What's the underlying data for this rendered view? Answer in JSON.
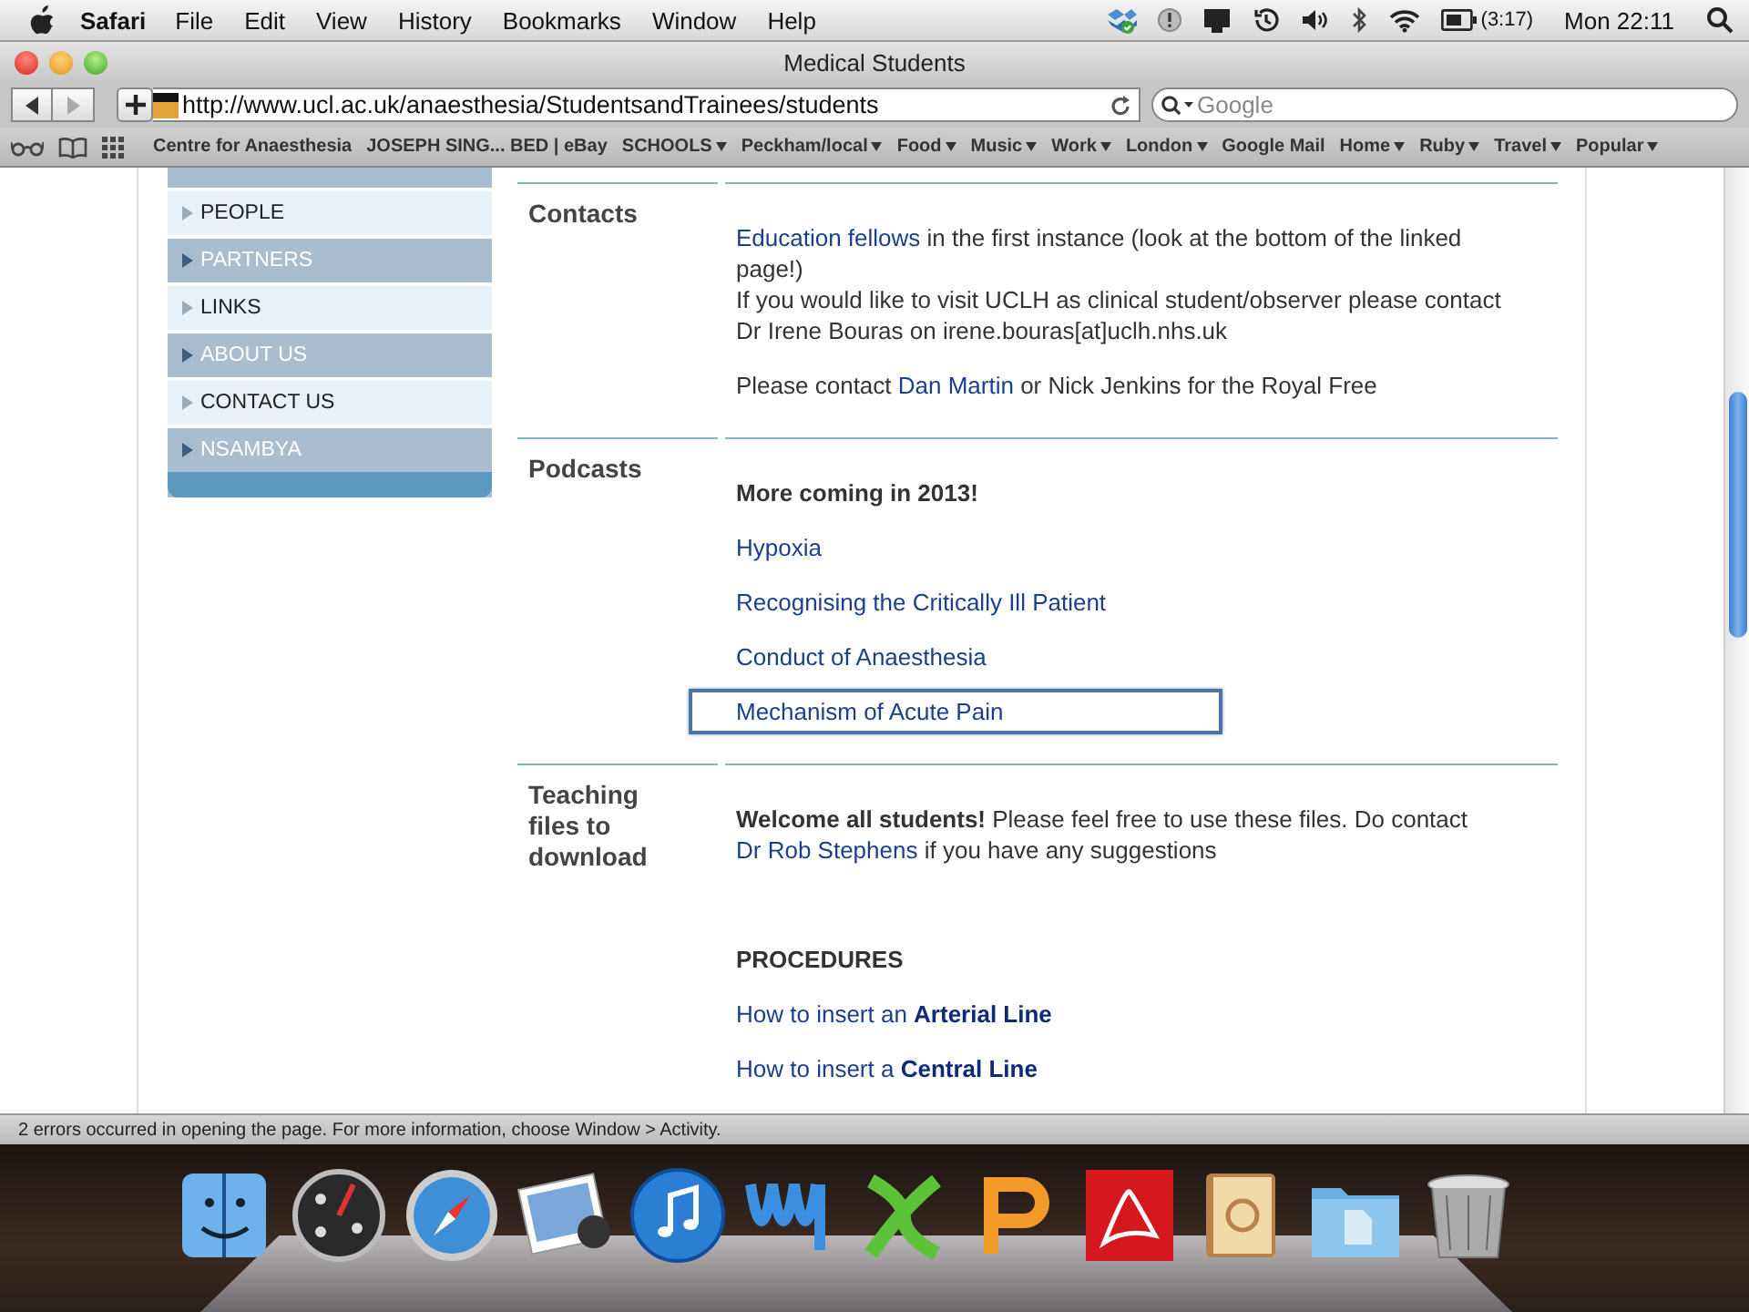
{
  "menu_bar": {
    "app": "Safari",
    "menus": [
      "File",
      "Edit",
      "View",
      "History",
      "Bookmarks",
      "Window",
      "Help"
    ],
    "battery_time": "(3:17)",
    "clock": "Mon 22:11"
  },
  "window": {
    "title": "Medical Students"
  },
  "toolbar": {
    "url": "http://www.ucl.ac.uk/anaesthesia/StudentsandTrainees/students",
    "search_placeholder": "Google"
  },
  "bookmarks": [
    {
      "label": "Centre for Anaesthesia",
      "menu": false
    },
    {
      "label": "JOSEPH SING... BED | eBay",
      "menu": false
    },
    {
      "label": "SCHOOLS",
      "menu": true
    },
    {
      "label": "Peckham/local",
      "menu": true
    },
    {
      "label": "Food",
      "menu": true
    },
    {
      "label": "Music",
      "menu": true
    },
    {
      "label": "Work",
      "menu": true
    },
    {
      "label": "London",
      "menu": true
    },
    {
      "label": "Google Mail",
      "menu": false
    },
    {
      "label": "Home",
      "menu": true
    },
    {
      "label": "Ruby",
      "menu": true
    },
    {
      "label": "Travel",
      "menu": true
    },
    {
      "label": "Popular",
      "menu": true
    }
  ],
  "sidebar": {
    "items": [
      {
        "label": "PEOPLE",
        "kind": "light"
      },
      {
        "label": "PARTNERS",
        "kind": "dark"
      },
      {
        "label": "LINKS",
        "kind": "light"
      },
      {
        "label": "ABOUT US",
        "kind": "dark"
      },
      {
        "label": "CONTACT US",
        "kind": "light"
      },
      {
        "label": "NSAMBYA",
        "kind": "dark"
      }
    ]
  },
  "sections": [
    {
      "heading": "Contacts",
      "paragraphs": [
        {
          "lines": [
            [
              {
                "text": "Education fellows",
                "link": true
              },
              {
                "text": " in the first instance (look at the bottom of the linked page!)"
              }
            ],
            [
              {
                "text": "If you would like to visit UCLH as clinical student/observer please contact Dr Irene Bouras on irene.bouras[at]uclh.nhs.uk"
              }
            ]
          ]
        },
        {
          "lines": [
            [
              {
                "text": "Please contact "
              },
              {
                "text": "Dan Martin",
                "link": true
              },
              {
                "text": " or Nick Jenkins for the Royal Free"
              }
            ]
          ]
        }
      ]
    },
    {
      "heading": "Podcasts",
      "paragraphs": [
        {
          "lines": [
            [
              {
                "text": "More coming in 2013!",
                "bold": true
              }
            ]
          ]
        },
        {
          "lines": [
            [
              {
                "text": "Hypoxia",
                "link": true,
                "focused": false
              }
            ]
          ]
        },
        {
          "lines": [
            [
              {
                "text": "Recognising the Critically Ill Patient",
                "link": true,
                "focused": false
              }
            ]
          ]
        },
        {
          "lines": [
            [
              {
                "text": "Conduct of Anaesthesia",
                "link": true,
                "focused": false
              }
            ]
          ]
        },
        {
          "lines": [
            [
              {
                "text": "Mechanism of Acute Pain",
                "link": true,
                "focused": true
              }
            ]
          ]
        }
      ]
    },
    {
      "heading": "Teaching files to download",
      "paragraphs": [
        {
          "lines": [
            [
              {
                "text": "Welcome all students!",
                "bold": true
              },
              {
                "text": " Please feel free to use these files. Do contact "
              },
              {
                "text": "Dr Rob Stephens",
                "link": true
              },
              {
                "text": " if you have any suggestions"
              }
            ]
          ]
        }
      ],
      "subheading": "PROCEDURES",
      "links": [
        "How to insert an **Arterial Line**",
        "How to insert a **Central Line**"
      ]
    }
  ],
  "status_bar": {
    "text": "2 errors occurred in opening the page. For more information, choose Window > Activity."
  }
}
